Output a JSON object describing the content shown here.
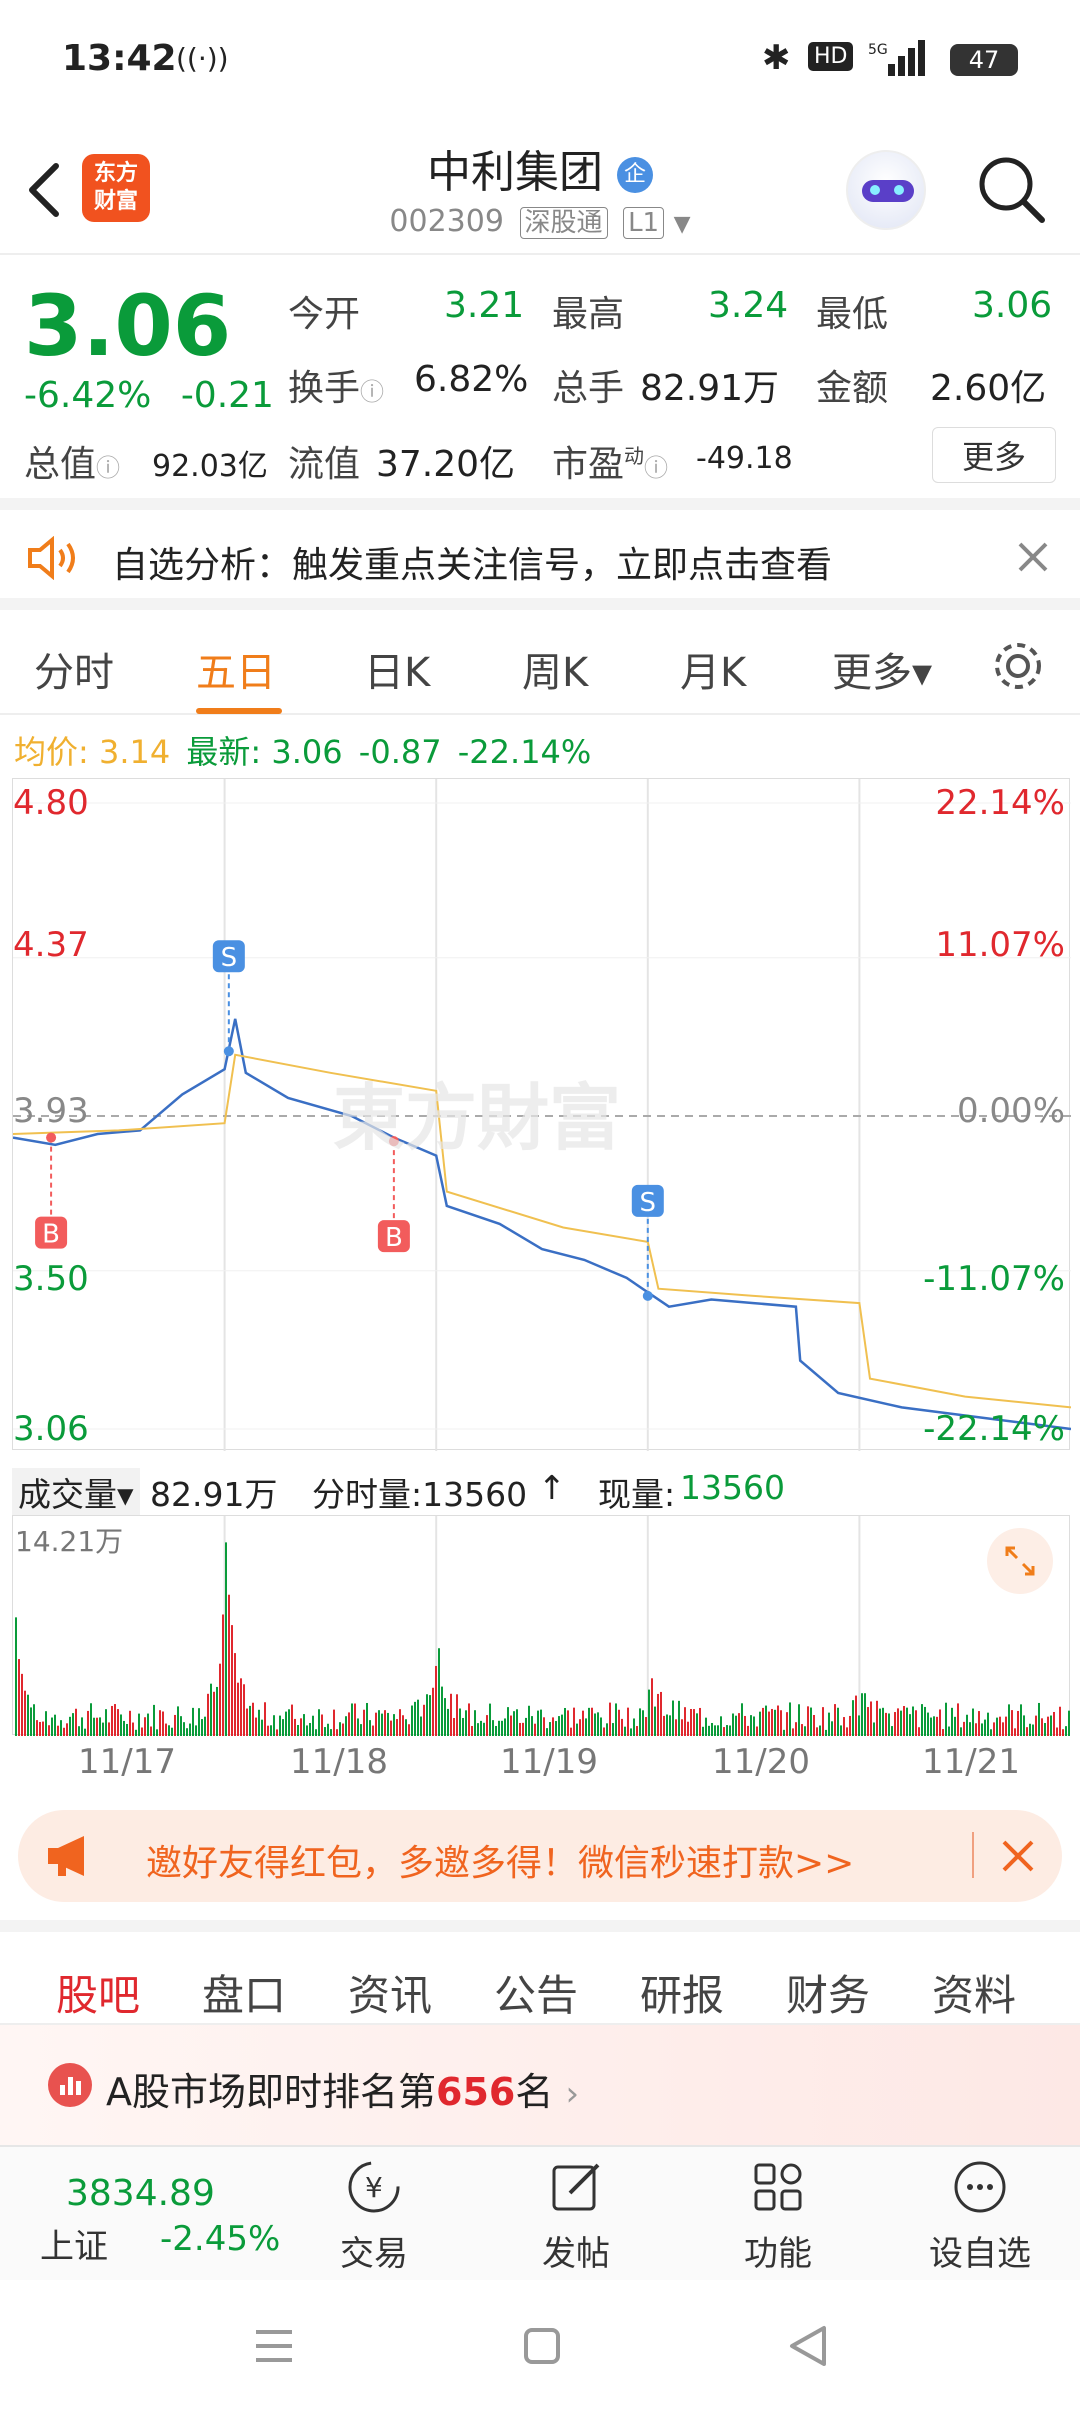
{
  "status_bar": {
    "time": "13:42",
    "battery": "47"
  },
  "header": {
    "logo_text_1": "东方",
    "logo_text_2": "财富",
    "title": "中利集团",
    "badge": "企",
    "code": "002309",
    "tag_1": "深股通",
    "tag_2": "L1"
  },
  "quote": {
    "price": "3.06",
    "change_pct": "-6.42%",
    "change": "-0.21",
    "open_label": "今开",
    "open": "3.21",
    "high_label": "最高",
    "high": "3.24",
    "low_label": "最低",
    "low": "3.06",
    "turnover_label": "换手",
    "turnover": "6.82%",
    "volume_label": "总手",
    "volume": "82.91万",
    "amount_label": "金额",
    "amount": "2.60亿",
    "mcap_label": "总值",
    "mcap": "92.03亿",
    "float_label": "流值",
    "float": "37.20亿",
    "pe_label": "市盈",
    "pe_sup": "动",
    "pe": "-49.18",
    "more_button": "更多"
  },
  "notice": {
    "text": "自选分析：触发重点关注信号，立即点击查看"
  },
  "kline_tabs": [
    {
      "label": "分时"
    },
    {
      "label": "五日"
    },
    {
      "label": "日K"
    },
    {
      "label": "周K"
    },
    {
      "label": "月K"
    },
    {
      "label": "更多▾"
    }
  ],
  "avg_line": {
    "avg_label": "均价:",
    "avg": "3.14",
    "latest_label": "最新:",
    "latest": "3.06",
    "latest_change": "-0.87",
    "latest_pct": "-22.14%"
  },
  "chart_data": {
    "type": "line",
    "title": "",
    "x_labels": [
      "11/17",
      "11/18",
      "11/19",
      "11/20",
      "11/21"
    ],
    "y_left_ticks": [
      "4.80",
      "4.37",
      "3.93",
      "3.50",
      "3.06"
    ],
    "y_right_ticks": [
      "22.14%",
      "11.07%",
      "0.00%",
      "-11.07%",
      "-22.14%"
    ],
    "ylim": [
      3.06,
      4.8
    ],
    "reference_price": 3.93,
    "series": [
      {
        "name": "价格",
        "points": [
          [
            0,
            3.87
          ],
          [
            0.2,
            3.85
          ],
          [
            0.4,
            3.88
          ],
          [
            0.6,
            3.89
          ],
          [
            0.8,
            3.99
          ],
          [
            1.0,
            4.06
          ],
          [
            1.05,
            4.2
          ],
          [
            1.1,
            4.05
          ],
          [
            1.3,
            3.98
          ],
          [
            1.6,
            3.93
          ],
          [
            1.8,
            3.87
          ],
          [
            2.0,
            3.82
          ],
          [
            2.05,
            3.68
          ],
          [
            2.3,
            3.63
          ],
          [
            2.5,
            3.56
          ],
          [
            2.7,
            3.53
          ],
          [
            2.9,
            3.48
          ],
          [
            3.0,
            3.44
          ],
          [
            3.1,
            3.4
          ],
          [
            3.3,
            3.42
          ],
          [
            3.5,
            3.41
          ],
          [
            3.7,
            3.4
          ],
          [
            3.72,
            3.25
          ],
          [
            3.9,
            3.16
          ],
          [
            4.2,
            3.12
          ],
          [
            4.6,
            3.09
          ],
          [
            5.0,
            3.06
          ]
        ]
      },
      {
        "name": "均价",
        "points": [
          [
            0,
            3.88
          ],
          [
            0.5,
            3.89
          ],
          [
            1.0,
            3.91
          ],
          [
            1.05,
            4.1
          ],
          [
            1.5,
            4.05
          ],
          [
            2.0,
            4.0
          ],
          [
            2.05,
            3.72
          ],
          [
            2.6,
            3.62
          ],
          [
            3.0,
            3.58
          ],
          [
            3.05,
            3.45
          ],
          [
            3.5,
            3.43
          ],
          [
            4.0,
            3.41
          ],
          [
            4.05,
            3.2
          ],
          [
            4.5,
            3.15
          ],
          [
            5.0,
            3.12
          ]
        ]
      }
    ],
    "markers": [
      {
        "label": "B",
        "x": 0.18,
        "y": 3.87,
        "color": "#f25c5c"
      },
      {
        "label": "S",
        "x": 1.02,
        "y": 4.11,
        "color": "#4a90e2"
      },
      {
        "label": "B",
        "x": 1.8,
        "y": 3.86,
        "color": "#f25c5c"
      },
      {
        "label": "S",
        "x": 3.0,
        "y": 3.43,
        "color": "#4a90e2"
      }
    ]
  },
  "volume": {
    "label": "成交量▾",
    "total": "82.91万",
    "tick_label": "分时量:13560",
    "arrow": "↑",
    "now_label": "现量:",
    "now_value": "13560",
    "max_label": "14.21万"
  },
  "promo": {
    "text": "邀好友得红包，多邀多得！微信秒速打款>>"
  },
  "bottom_tabs": [
    {
      "label": "股吧"
    },
    {
      "label": "盘口"
    },
    {
      "label": "资讯"
    },
    {
      "label": "公告"
    },
    {
      "label": "研报"
    },
    {
      "label": "财务"
    },
    {
      "label": "资料"
    }
  ],
  "rank": {
    "prefix": "A股市场即时排名第",
    "rank": "656",
    "suffix": "名"
  },
  "bottom_nav": {
    "index_value": "3834.89",
    "index_name": "上证",
    "index_pct": "-2.45%",
    "items": [
      {
        "label": "交易",
        "icon": "yen-trade-icon"
      },
      {
        "label": "发帖",
        "icon": "edit-icon"
      },
      {
        "label": "功能",
        "icon": "grid-icon"
      },
      {
        "label": "设自选",
        "icon": "more-icon"
      }
    ]
  }
}
